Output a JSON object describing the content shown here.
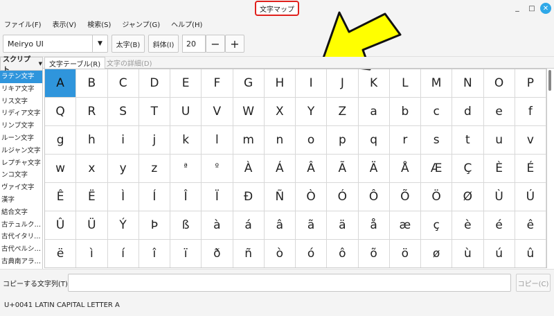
{
  "window": {
    "title": "文字マップ",
    "minimize_glyph": "_",
    "maximize_glyph": "□",
    "close_glyph": "✕"
  },
  "menu": {
    "items": [
      "ファイル(F)",
      "表示(V)",
      "検索(S)",
      "ジャンプ(G)",
      "ヘルプ(H)"
    ]
  },
  "toolbar": {
    "font_name": "Meiryo UI",
    "font_arrow": "▼",
    "bold_label": "太字(B)",
    "italic_label": "斜体(I)",
    "size_value": "20",
    "minus_label": "−",
    "plus_label": "+"
  },
  "script_list": {
    "header": "スクリプト",
    "header_caret": "▼",
    "items": [
      "ラテン文字",
      "リキア文字",
      "リス文字",
      "リディア文字",
      "リンブ文字",
      "ルーン文字",
      "ルジャン文字",
      "レプチャ文字",
      "ンコ文字",
      "ヴァイ文字",
      "漢字",
      "結合文字",
      "古テュルク…",
      "古代イタリ…",
      "古代ペルシ…",
      "古典南アラ…"
    ],
    "selected_index": 0
  },
  "tabs": {
    "table": "文字テーブル(R)",
    "detail": "文字の詳細(D)"
  },
  "grid": {
    "selected": "0.0",
    "rows": [
      [
        "A",
        "B",
        "C",
        "D",
        "E",
        "F",
        "G",
        "H",
        "I",
        "J",
        "K",
        "L",
        "M",
        "N",
        "O",
        "P"
      ],
      [
        "Q",
        "R",
        "S",
        "T",
        "U",
        "V",
        "W",
        "X",
        "Y",
        "Z",
        "a",
        "b",
        "c",
        "d",
        "e",
        "f"
      ],
      [
        "g",
        "h",
        "i",
        "j",
        "k",
        "l",
        "m",
        "n",
        "o",
        "p",
        "q",
        "r",
        "s",
        "t",
        "u",
        "v"
      ],
      [
        "w",
        "x",
        "y",
        "z",
        "ª",
        "º",
        "À",
        "Á",
        "Â",
        "Ã",
        "Ä",
        "Å",
        "Æ",
        "Ç",
        "È",
        "É"
      ],
      [
        "Ê",
        "Ë",
        "Ì",
        "Í",
        "Î",
        "Ï",
        "Ð",
        "Ñ",
        "Ò",
        "Ó",
        "Ô",
        "Õ",
        "Ö",
        "Ø",
        "Ù",
        "Ú"
      ],
      [
        "Û",
        "Ü",
        "Ý",
        "Þ",
        "ß",
        "à",
        "á",
        "â",
        "ã",
        "ä",
        "å",
        "æ",
        "ç",
        "è",
        "é",
        "ê"
      ],
      [
        "ë",
        "ì",
        "í",
        "î",
        "ï",
        "ð",
        "ñ",
        "ò",
        "ó",
        "ô",
        "õ",
        "ö",
        "ø",
        "ù",
        "ú",
        "û"
      ]
    ]
  },
  "copy_bar": {
    "label": "コピーする文字列(T):",
    "value": "",
    "copy_button": "コピー(C)"
  },
  "status": {
    "text": "U+0041 LATIN CAPITAL LETTER A"
  },
  "colors": {
    "selection": "#2f95dc",
    "title_highlight": "#e0201c",
    "annotation_arrow": "#ffff00",
    "close_button": "#2fa8e8"
  }
}
